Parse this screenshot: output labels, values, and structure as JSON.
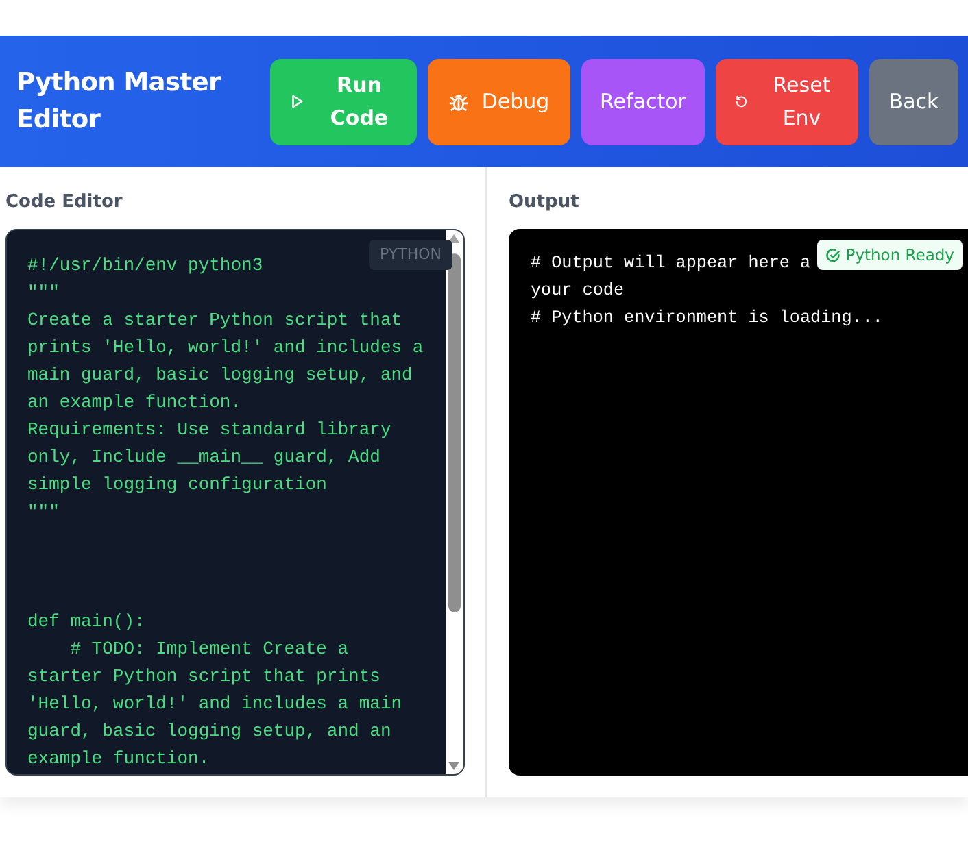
{
  "header": {
    "title": "Python Master Editor",
    "buttons": [
      {
        "label": "Run Code",
        "kind": "run"
      },
      {
        "label": "Debug",
        "kind": "debug"
      },
      {
        "label": "Refactor",
        "kind": "refactor"
      },
      {
        "label": "Reset Env",
        "kind": "reset"
      },
      {
        "label": "Back",
        "kind": "back"
      }
    ]
  },
  "editor": {
    "heading": "Code Editor",
    "language": "PYTHON",
    "code": "#!/usr/bin/env python3\n\"\"\"\nCreate a starter Python script that\nprints 'Hello, world!' and includes a\nmain guard, basic logging setup, and\nan example function.\nRequirements: Use standard library\nonly, Include __main__ guard, Add\nsimple logging configuration\n\"\"\"\n\n\n\ndef main():\n    # TODO: Implement Create a\nstarter Python script that prints\n'Hello, world!' and includes a main\nguard, basic logging setup, and an\nexample function."
  },
  "output": {
    "heading": "Output",
    "status": "Python Ready",
    "lines": [
      "# Output will appear here a",
      "your code",
      "# Python environment is loading..."
    ]
  }
}
